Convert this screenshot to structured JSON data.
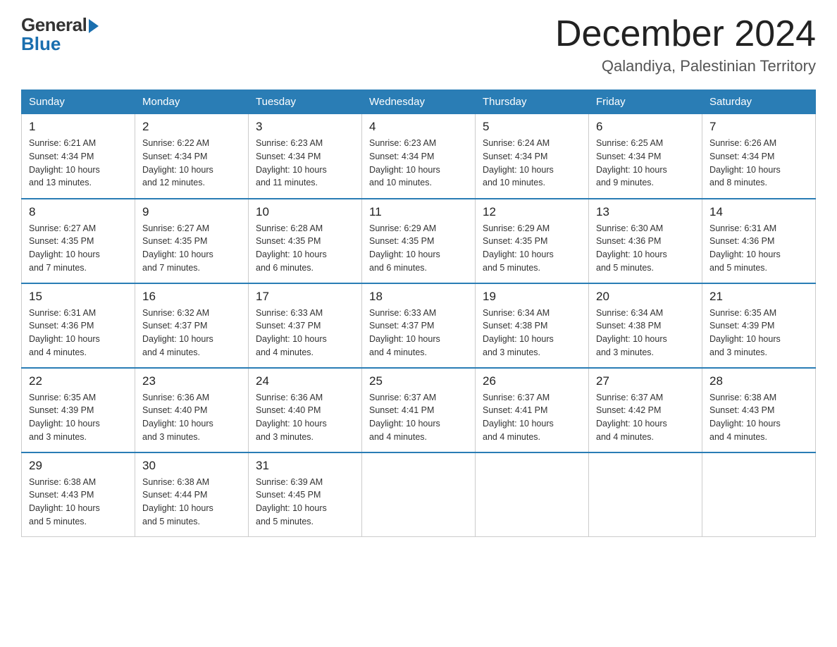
{
  "logo": {
    "general": "General",
    "blue": "Blue"
  },
  "header": {
    "month": "December 2024",
    "location": "Qalandiya, Palestinian Territory"
  },
  "weekdays": [
    "Sunday",
    "Monday",
    "Tuesday",
    "Wednesday",
    "Thursday",
    "Friday",
    "Saturday"
  ],
  "weeks": [
    [
      {
        "day": "1",
        "sunrise": "6:21 AM",
        "sunset": "4:34 PM",
        "daylight": "10 hours and 13 minutes."
      },
      {
        "day": "2",
        "sunrise": "6:22 AM",
        "sunset": "4:34 PM",
        "daylight": "10 hours and 12 minutes."
      },
      {
        "day": "3",
        "sunrise": "6:23 AM",
        "sunset": "4:34 PM",
        "daylight": "10 hours and 11 minutes."
      },
      {
        "day": "4",
        "sunrise": "6:23 AM",
        "sunset": "4:34 PM",
        "daylight": "10 hours and 10 minutes."
      },
      {
        "day": "5",
        "sunrise": "6:24 AM",
        "sunset": "4:34 PM",
        "daylight": "10 hours and 10 minutes."
      },
      {
        "day": "6",
        "sunrise": "6:25 AM",
        "sunset": "4:34 PM",
        "daylight": "10 hours and 9 minutes."
      },
      {
        "day": "7",
        "sunrise": "6:26 AM",
        "sunset": "4:34 PM",
        "daylight": "10 hours and 8 minutes."
      }
    ],
    [
      {
        "day": "8",
        "sunrise": "6:27 AM",
        "sunset": "4:35 PM",
        "daylight": "10 hours and 7 minutes."
      },
      {
        "day": "9",
        "sunrise": "6:27 AM",
        "sunset": "4:35 PM",
        "daylight": "10 hours and 7 minutes."
      },
      {
        "day": "10",
        "sunrise": "6:28 AM",
        "sunset": "4:35 PM",
        "daylight": "10 hours and 6 minutes."
      },
      {
        "day": "11",
        "sunrise": "6:29 AM",
        "sunset": "4:35 PM",
        "daylight": "10 hours and 6 minutes."
      },
      {
        "day": "12",
        "sunrise": "6:29 AM",
        "sunset": "4:35 PM",
        "daylight": "10 hours and 5 minutes."
      },
      {
        "day": "13",
        "sunrise": "6:30 AM",
        "sunset": "4:36 PM",
        "daylight": "10 hours and 5 minutes."
      },
      {
        "day": "14",
        "sunrise": "6:31 AM",
        "sunset": "4:36 PM",
        "daylight": "10 hours and 5 minutes."
      }
    ],
    [
      {
        "day": "15",
        "sunrise": "6:31 AM",
        "sunset": "4:36 PM",
        "daylight": "10 hours and 4 minutes."
      },
      {
        "day": "16",
        "sunrise": "6:32 AM",
        "sunset": "4:37 PM",
        "daylight": "10 hours and 4 minutes."
      },
      {
        "day": "17",
        "sunrise": "6:33 AM",
        "sunset": "4:37 PM",
        "daylight": "10 hours and 4 minutes."
      },
      {
        "day": "18",
        "sunrise": "6:33 AM",
        "sunset": "4:37 PM",
        "daylight": "10 hours and 4 minutes."
      },
      {
        "day": "19",
        "sunrise": "6:34 AM",
        "sunset": "4:38 PM",
        "daylight": "10 hours and 3 minutes."
      },
      {
        "day": "20",
        "sunrise": "6:34 AM",
        "sunset": "4:38 PM",
        "daylight": "10 hours and 3 minutes."
      },
      {
        "day": "21",
        "sunrise": "6:35 AM",
        "sunset": "4:39 PM",
        "daylight": "10 hours and 3 minutes."
      }
    ],
    [
      {
        "day": "22",
        "sunrise": "6:35 AM",
        "sunset": "4:39 PM",
        "daylight": "10 hours and 3 minutes."
      },
      {
        "day": "23",
        "sunrise": "6:36 AM",
        "sunset": "4:40 PM",
        "daylight": "10 hours and 3 minutes."
      },
      {
        "day": "24",
        "sunrise": "6:36 AM",
        "sunset": "4:40 PM",
        "daylight": "10 hours and 3 minutes."
      },
      {
        "day": "25",
        "sunrise": "6:37 AM",
        "sunset": "4:41 PM",
        "daylight": "10 hours and 4 minutes."
      },
      {
        "day": "26",
        "sunrise": "6:37 AM",
        "sunset": "4:41 PM",
        "daylight": "10 hours and 4 minutes."
      },
      {
        "day": "27",
        "sunrise": "6:37 AM",
        "sunset": "4:42 PM",
        "daylight": "10 hours and 4 minutes."
      },
      {
        "day": "28",
        "sunrise": "6:38 AM",
        "sunset": "4:43 PM",
        "daylight": "10 hours and 4 minutes."
      }
    ],
    [
      {
        "day": "29",
        "sunrise": "6:38 AM",
        "sunset": "4:43 PM",
        "daylight": "10 hours and 5 minutes."
      },
      {
        "day": "30",
        "sunrise": "6:38 AM",
        "sunset": "4:44 PM",
        "daylight": "10 hours and 5 minutes."
      },
      {
        "day": "31",
        "sunrise": "6:39 AM",
        "sunset": "4:45 PM",
        "daylight": "10 hours and 5 minutes."
      },
      null,
      null,
      null,
      null
    ]
  ],
  "labels": {
    "sunrise": "Sunrise:",
    "sunset": "Sunset:",
    "daylight": "Daylight:"
  }
}
